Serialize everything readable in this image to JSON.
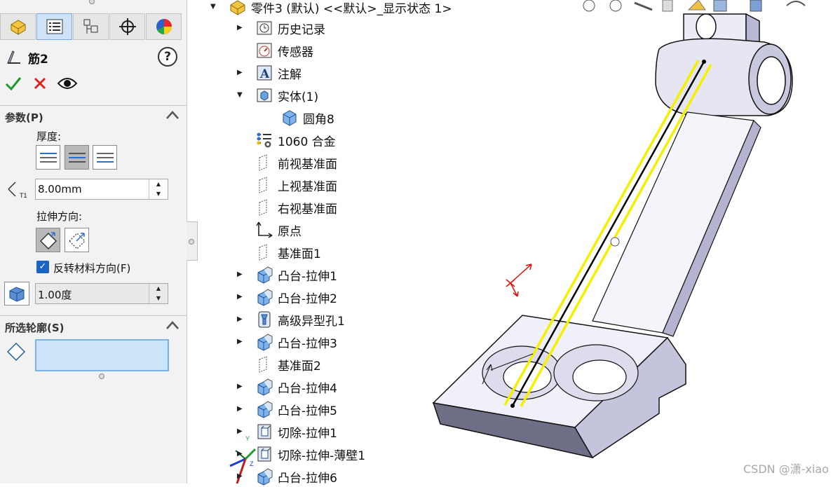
{
  "pm": {
    "title": "筋2",
    "help": "?",
    "params_section": "参数(P)",
    "thickness_label": "厚度:",
    "thickness_value": "8.00mm",
    "direction_label": "拉伸方向:",
    "flip_label": "反转材料方向(F)",
    "flip_checked": true,
    "draft_value": "1.00度",
    "profile_section": "所选轮廓(S)"
  },
  "tree": {
    "root": "零件3 (默认) <<默认>_显示状态 1>",
    "items": [
      {
        "label": "历史记录",
        "icon": "history-icon",
        "expandable": true
      },
      {
        "label": "传感器",
        "icon": "sensor-icon",
        "expandable": false
      },
      {
        "label": "注解",
        "icon": "annotation-icon",
        "expandable": true
      },
      {
        "label": "实体(1)",
        "icon": "solid-bodies-icon",
        "expandable": true,
        "expanded": true
      },
      {
        "label": "圆角8",
        "icon": "solid-body-icon",
        "expandable": false,
        "child": true
      },
      {
        "label": "1060 合金",
        "icon": "material-icon",
        "expandable": false
      },
      {
        "label": "前视基准面",
        "icon": "plane-icon",
        "expandable": false
      },
      {
        "label": "上视基准面",
        "icon": "plane-icon",
        "expandable": false
      },
      {
        "label": "右视基准面",
        "icon": "plane-icon",
        "expandable": false
      },
      {
        "label": "原点",
        "icon": "origin-icon",
        "expandable": false
      },
      {
        "label": "基准面1",
        "icon": "plane-icon",
        "expandable": false
      },
      {
        "label": "凸台-拉伸1",
        "icon": "boss-extrude-icon",
        "expandable": true
      },
      {
        "label": "凸台-拉伸2",
        "icon": "boss-extrude-icon",
        "expandable": true
      },
      {
        "label": "高级异型孔1",
        "icon": "hole-wizard-icon",
        "expandable": true
      },
      {
        "label": "凸台-拉伸3",
        "icon": "boss-extrude-icon",
        "expandable": true
      },
      {
        "label": "基准面2",
        "icon": "plane-icon",
        "expandable": false
      },
      {
        "label": "凸台-拉伸4",
        "icon": "boss-extrude-icon",
        "expandable": true
      },
      {
        "label": "凸台-拉伸5",
        "icon": "boss-extrude-icon",
        "expandable": true
      },
      {
        "label": "切除-拉伸1",
        "icon": "cut-extrude-icon",
        "expandable": true
      },
      {
        "label": "切除-拉伸-薄壁1",
        "icon": "cut-extrude-icon",
        "expandable": true
      },
      {
        "label": "凸台-拉伸6",
        "icon": "boss-extrude-icon",
        "expandable": true
      }
    ]
  },
  "triad": {
    "x": "X",
    "y": "Y",
    "z": "Z"
  },
  "watermark": "CSDN @潇-xiao",
  "colors": {
    "accent": "#1a64c4",
    "profile_fill": "#cce4f7",
    "rib_lines": "#f5f000",
    "model": "#e8e8f4"
  }
}
